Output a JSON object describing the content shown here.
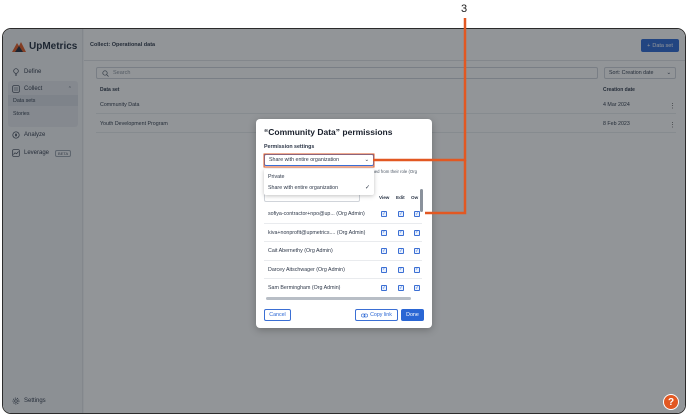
{
  "callout": {
    "number": "3"
  },
  "brand": {
    "name": "UpMetrics"
  },
  "sidebar": {
    "define": "Define",
    "collect": "Collect",
    "data_sets": "Data sets",
    "stories": "Stories",
    "analyze": "Analyze",
    "leverage": "Leverage",
    "beta": "BETA",
    "settings": "Settings"
  },
  "header": {
    "breadcrumb": "Collect: Operational data",
    "add_button": "Data set"
  },
  "toolbar": {
    "search_placeholder": "Search",
    "sort_label": "Sort: Creation date"
  },
  "table": {
    "columns": {
      "name": "Data set",
      "date": "Creation date"
    },
    "rows": [
      {
        "name": "Community Data",
        "date": "4 Mar 2024"
      },
      {
        "name": "Youth Development Program",
        "date": "8 Feb 2023"
      }
    ]
  },
  "modal": {
    "title": "“Community Data” permissions",
    "settings_label": "Permission settings",
    "selected": "Share with entire organization",
    "helper": "gned from their role (Org",
    "options": [
      "Private",
      "Share with entire organization"
    ],
    "columns": {
      "view": "View",
      "edit": "Edit",
      "own": "Ow"
    },
    "users": [
      {
        "name": "sofiya-contractor+npo@up... (Org Admin)"
      },
      {
        "name": "kiva+nonprofit@upmetrics.... (Org Admin)"
      },
      {
        "name": "Cait Abernethy  (Org Admin)"
      },
      {
        "name": "Darcey Aitschwager  (Org Admin)"
      },
      {
        "name": "Sam Bermingham  (Org Admin)"
      }
    ],
    "cancel": "Cancel",
    "copy_link": "Copy link",
    "done": "Done"
  },
  "help": {
    "label": "?"
  },
  "colors": {
    "accent": "#2a66d4",
    "callout": "#e25822",
    "help": "#e25822"
  }
}
